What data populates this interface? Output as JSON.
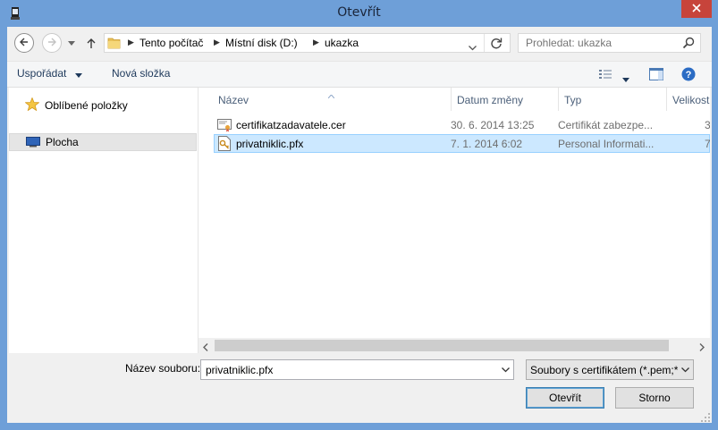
{
  "window": {
    "title": "Otevřít",
    "accent": "#6e9fd8",
    "close_color": "#c7443b"
  },
  "address": {
    "segments": [
      "Tento počítač",
      "Místní disk (D:)",
      "ukazka"
    ]
  },
  "search": {
    "placeholder": "Prohledat: ukazka"
  },
  "toolbar": {
    "organize_label": "Uspořádat",
    "new_folder_label": "Nová složka"
  },
  "navpane": {
    "items": [
      {
        "label": "Oblíbené položky",
        "icon": "star-icon"
      },
      {
        "label": "Plocha",
        "icon": "desktop-icon"
      }
    ]
  },
  "columns": {
    "name": "Název",
    "date": "Datum změny",
    "type": "Typ",
    "size": "Velikost"
  },
  "files": [
    {
      "name": "certifikatzadavatele.cer",
      "date": "30. 6. 2014 13:25",
      "type": "Certifikát zabezpe...",
      "size": "3",
      "icon": "certificate-file-icon"
    },
    {
      "name": "privatniklic.pfx",
      "date": "7. 1. 2014 6:02",
      "type": "Personal Informati...",
      "size": "7",
      "icon": "pfx-file-icon",
      "selected": true
    }
  ],
  "bottom": {
    "filename_label": "Název souboru:",
    "filename_value": "privatniklic.pfx",
    "filter_value": "Soubory s certifikátem (*.pem;*",
    "open_label": "Otevřít",
    "cancel_label": "Storno"
  }
}
